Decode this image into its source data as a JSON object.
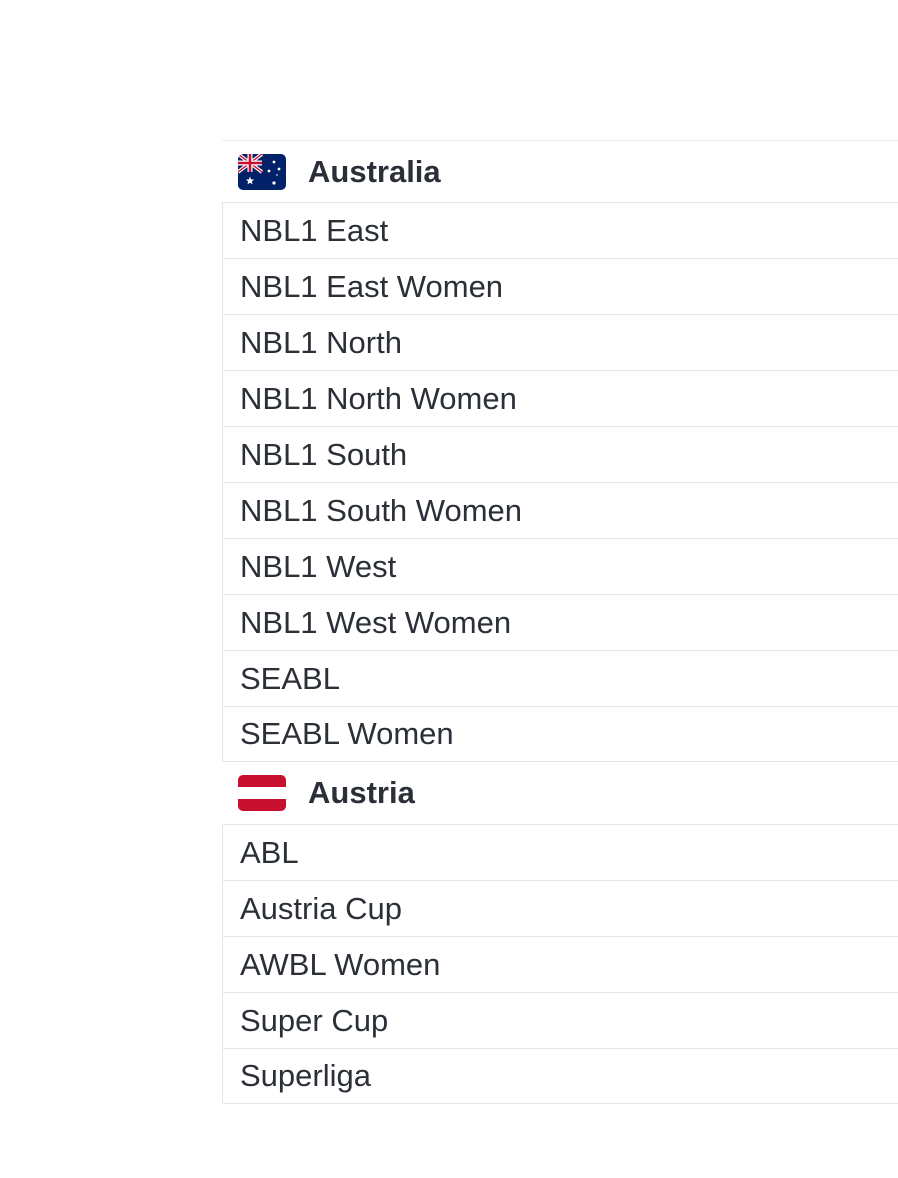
{
  "countries": [
    {
      "name": "Australia",
      "flag": "australia-flag",
      "leagues": [
        "NBL1 East",
        "NBL1 East Women",
        "NBL1 North",
        "NBL1 North Women",
        "NBL1 South",
        "NBL1 South Women",
        "NBL1 West",
        "NBL1 West Women",
        "SEABL",
        "SEABL Women"
      ]
    },
    {
      "name": "Austria",
      "flag": "austria-flag",
      "leagues": [
        "ABL",
        "Austria Cup",
        "AWBL Women",
        "Super Cup",
        "Superliga"
      ]
    }
  ],
  "colors": {
    "text": "#2b2f38",
    "divider": "#e6e6e6",
    "australia_blue": "#012169",
    "austria_red": "#c8102e"
  }
}
